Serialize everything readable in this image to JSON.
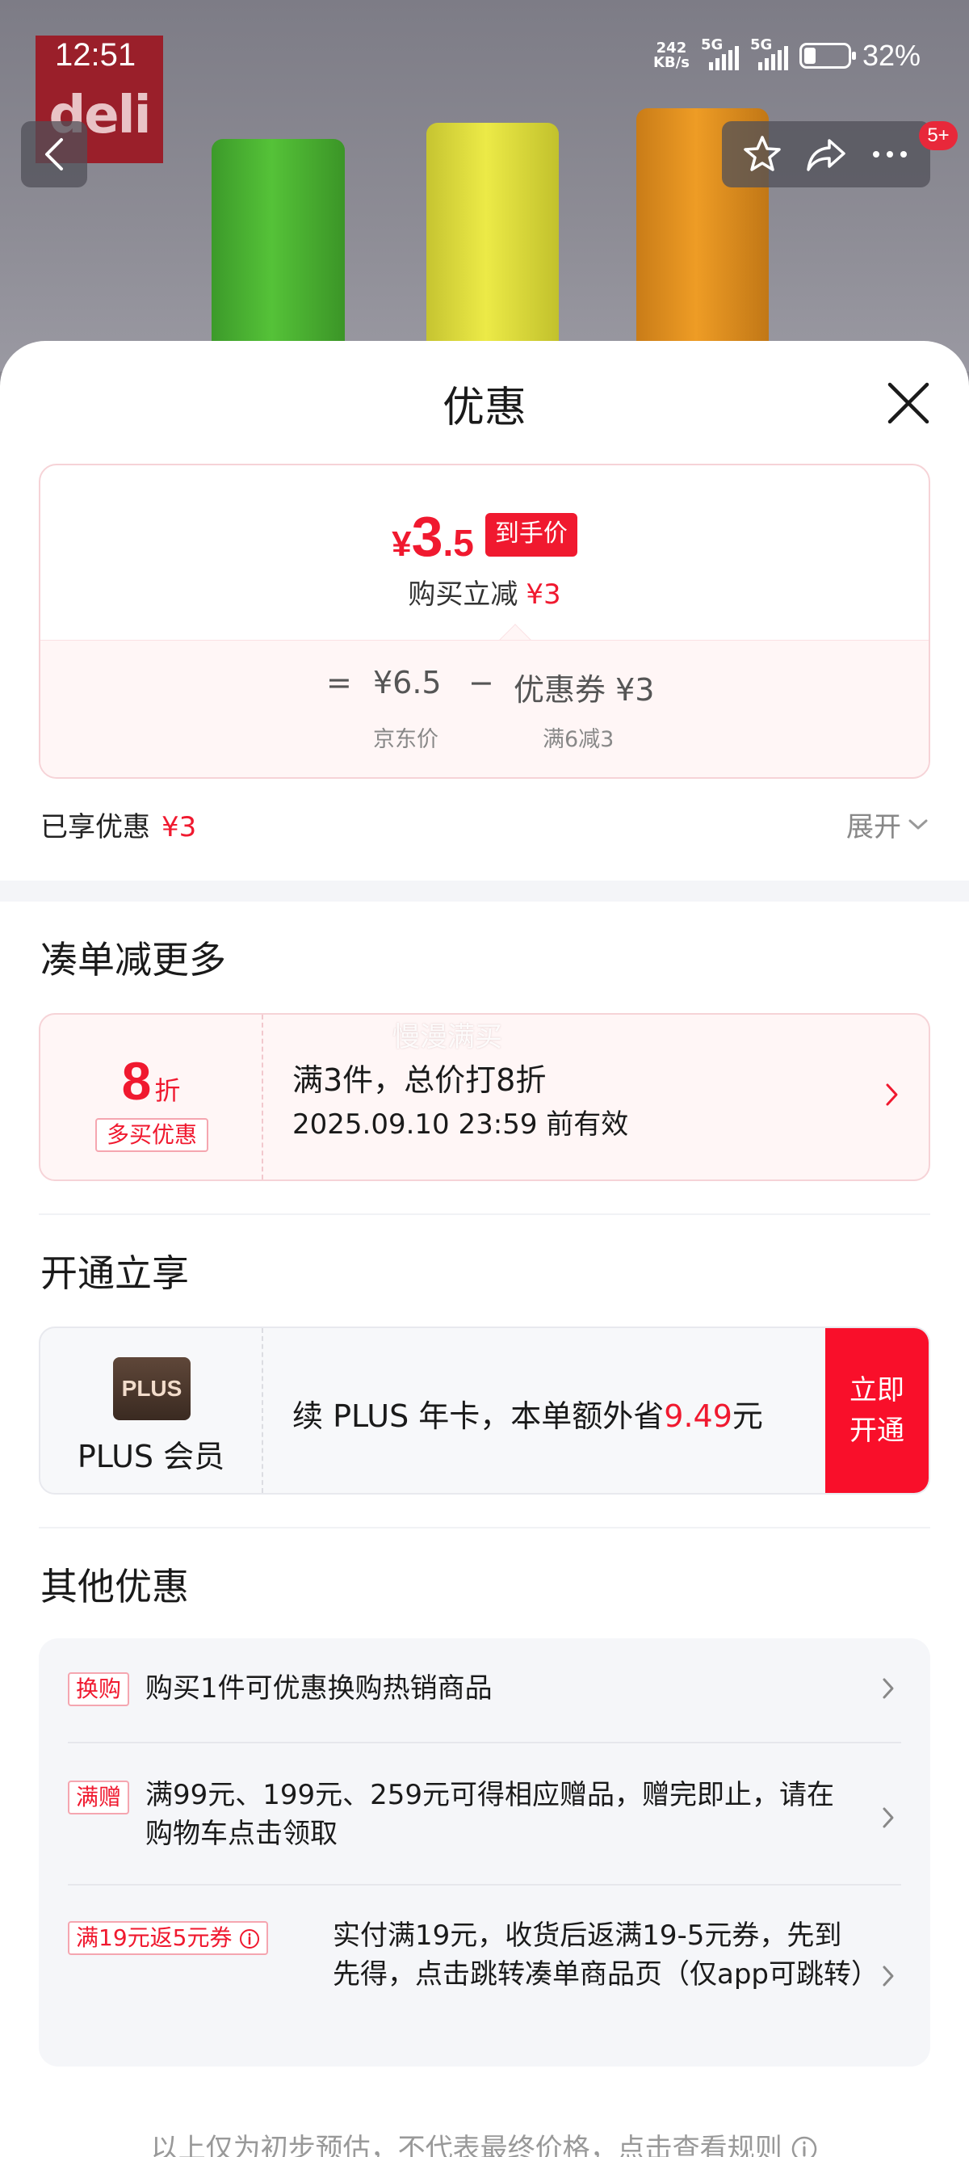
{
  "status_bar": {
    "time": "12:51",
    "speed_value": "242",
    "speed_unit": "KB/s",
    "net1": "5G",
    "net2": "5G",
    "battery": "32%"
  },
  "background": {
    "brand_logo": "deli"
  },
  "top_actions": {
    "cart_badge": "5+"
  },
  "sheet": {
    "title": "优惠"
  },
  "price_card": {
    "yen": "¥",
    "price_int": "3",
    "price_dec": ".5",
    "tag": "到手价",
    "reduce_label": "购买立减",
    "reduce_value": "¥3",
    "equals": "=",
    "jd_price": "¥6.5",
    "jd_price_label": "京东价",
    "minus": "−",
    "coupon": "优惠券 ¥3",
    "coupon_label": "满6减3"
  },
  "enjoyed": {
    "label": "已享优惠",
    "value": "¥3",
    "expand": "展开"
  },
  "combo": {
    "title": "凑单减更多",
    "discount_value": "8",
    "discount_unit": "折",
    "tag": "多买优惠",
    "line1": "满3件，总价打8折",
    "line2": "2025.09.10 23:59 前有效",
    "watermark": "慢漫满买"
  },
  "plus": {
    "title": "开通立享",
    "logo": "PLUS",
    "name": "PLUS 会员",
    "text_prefix": "续 PLUS 年卡，本单额外省",
    "amount": "9.49",
    "text_suffix": "元",
    "button_line1": "立即",
    "button_line2": "开通"
  },
  "other": {
    "title": "其他优惠",
    "items": [
      {
        "tag": "换购",
        "text": "购买1件可优惠换购热销商品"
      },
      {
        "tag": "满赠",
        "text": "满99元、199元、259元可得相应赠品，赠完即止，请在购物车点击领取"
      },
      {
        "tag": "满19元返5元券",
        "text": "实付满19元，收货后返满19-5元券，先到先得，点击跳转凑单商品页（仅app可跳转）"
      }
    ]
  },
  "footer": {
    "note": "以上仅为初步预估，不代表最终价格，点击查看规则"
  },
  "colors": {
    "accent_red": "#f0192f",
    "plus_brown": "#4a372c",
    "sheet_bg": "#ffffff"
  }
}
